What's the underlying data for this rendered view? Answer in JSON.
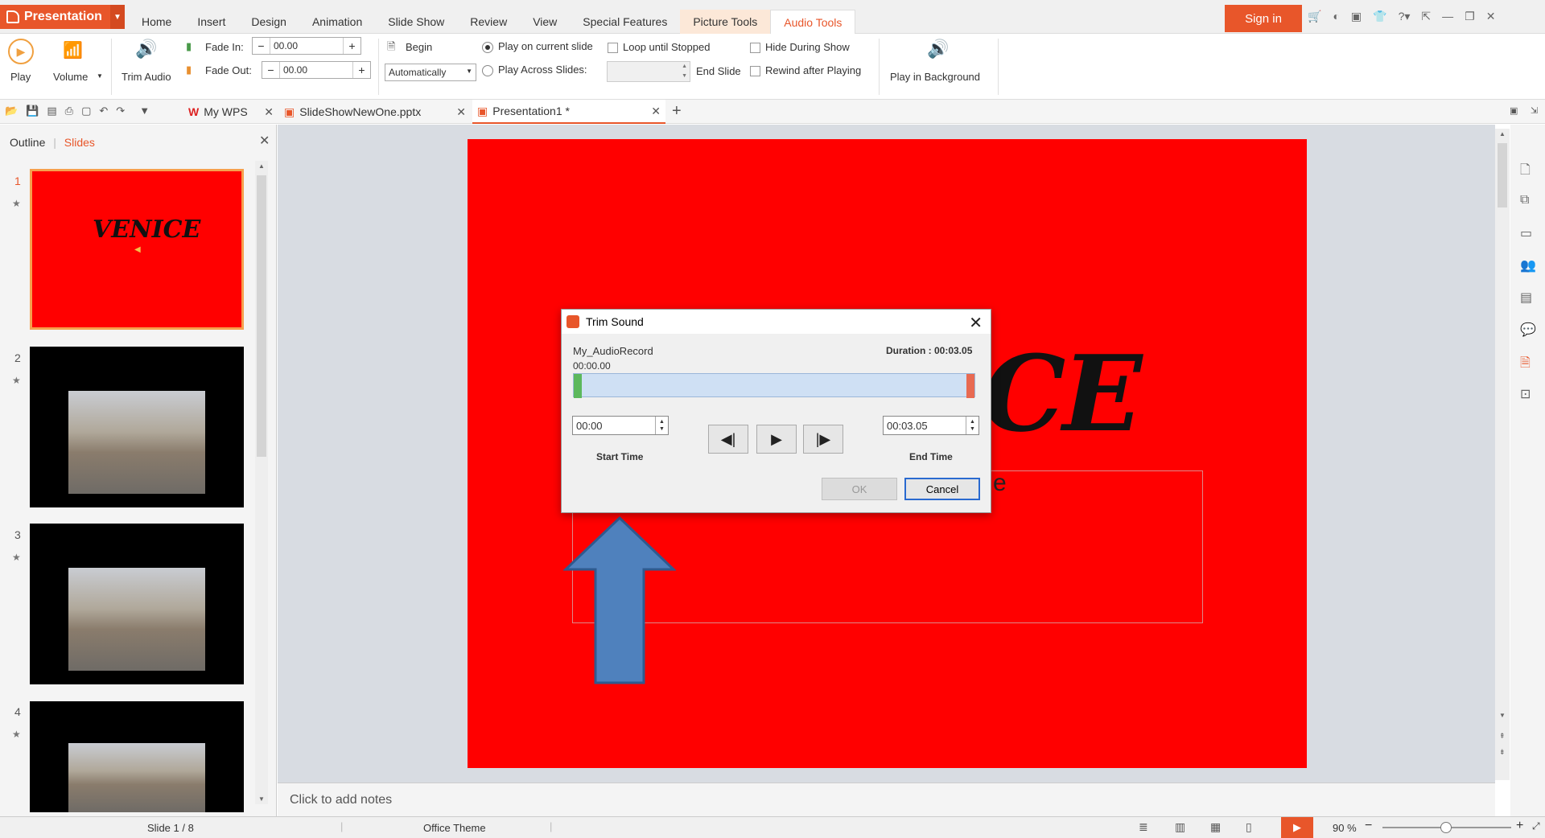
{
  "app": {
    "name": "Presentation",
    "sign_in": "Sign in"
  },
  "menu_tabs": [
    "Home",
    "Insert",
    "Design",
    "Animation",
    "Slide Show",
    "Review",
    "View",
    "Special Features",
    "Picture Tools",
    "Audio Tools"
  ],
  "ribbon": {
    "play": "Play",
    "volume": "Volume",
    "trim_audio": "Trim Audio",
    "fade_in_label": "Fade In:",
    "fade_in_value": "00.00",
    "fade_out_label": "Fade Out:",
    "fade_out_value": "00.00",
    "begin": "Begin",
    "begin_mode": "Automatically",
    "play_current_slide": "Play on current slide",
    "play_across_slides": "Play Across Slides:",
    "end_slide": "End Slide",
    "loop_until_stopped": "Loop until Stopped",
    "hide_during_show": "Hide During Show",
    "rewind_after_playing": "Rewind after Playing",
    "play_in_background": "Play in Background"
  },
  "doc_tabs": [
    "My WPS",
    "SlideShowNewOne.pptx",
    "Presentation1 *"
  ],
  "left_panel": {
    "outline": "Outline",
    "slides": "Slides",
    "slide_numbers": [
      "1",
      "2",
      "3",
      "4"
    ],
    "slide1_title": "VENICE"
  },
  "slide": {
    "title_fragment": "CE",
    "subtitle_fragment": "e"
  },
  "notes": "Click to add notes",
  "status": {
    "slide": "Slide 1 / 8",
    "theme": "Office Theme",
    "zoom": "90 %"
  },
  "dialog": {
    "title": "Trim Sound",
    "file": "My_AudioRecord",
    "duration": "Duration : 00:03.05",
    "position": "00:00.00",
    "start_value": "00:00",
    "end_value": "00:03.05",
    "start_label": "Start Time",
    "end_label": "End Time",
    "ok": "OK",
    "cancel": "Cancel"
  },
  "colors": {
    "accent": "#e8562a",
    "slide_bg": "#ff0000",
    "arrow": "#4f81bd"
  }
}
